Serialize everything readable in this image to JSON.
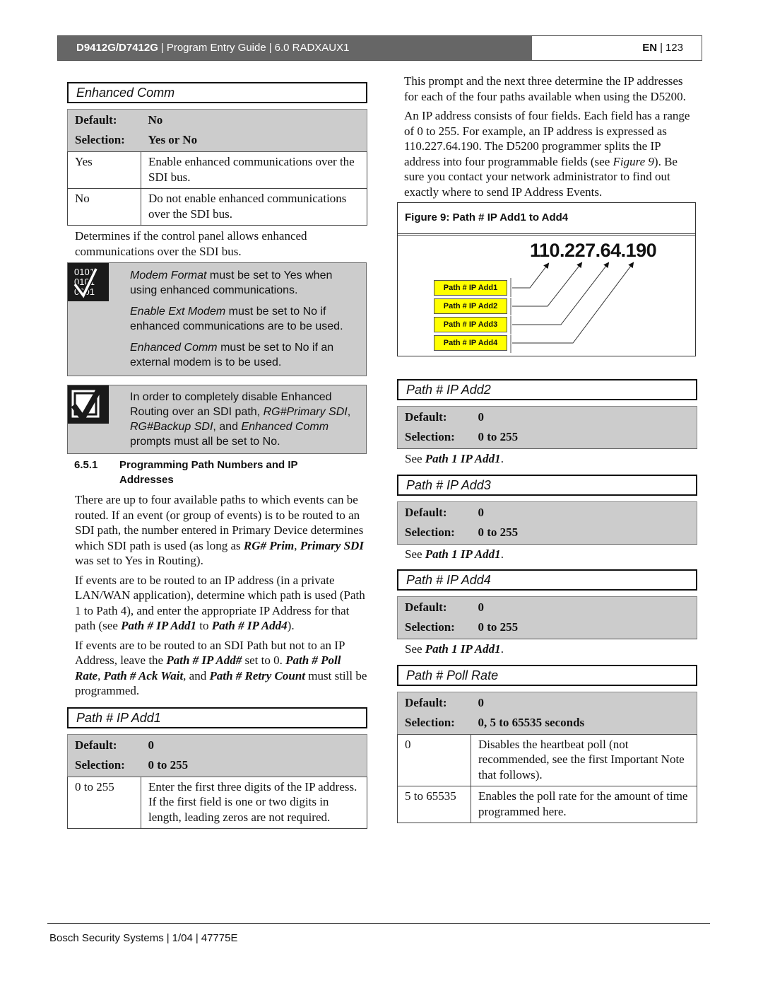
{
  "header": {
    "model": "D9412G/D7412G",
    "guide": "Program Entry Guide",
    "section": "6.0  RADXAUX1",
    "separator": "|",
    "lang": "EN",
    "page": "123"
  },
  "enhanced_comm": {
    "title": "Enhanced Comm",
    "default_label": "Default:",
    "default_value": "No",
    "selection_label": "Selection:",
    "selection_value": "Yes or No",
    "rows": [
      {
        "value": "Yes",
        "desc": "Enable enhanced communications over the SDI bus."
      },
      {
        "value": "No",
        "desc": "Do not enable enhanced communications over the SDI bus."
      }
    ],
    "description": "Determines if the control panel allows enhanced communications over the SDI bus."
  },
  "note1": {
    "icon": "binary-checkmark-icon",
    "items": [
      {
        "em": "Modem Format",
        "text": " must be set to Yes when using enhanced communications."
      },
      {
        "em": "Enable Ext Modem",
        "text": " must be set to No if enhanced communications are to be used."
      },
      {
        "em": "Enhanced Comm",
        "text": " must be set to No if an external modem is to be used."
      }
    ]
  },
  "note2": {
    "icon": "checkbox-checkmark-icon",
    "t1": "In order to completely disable Enhanced Routing over an SDI path, ",
    "em1": "RG#Primary SDI",
    "t2": ", ",
    "em2": "RG#Backup SDI",
    "t3": ", and ",
    "em3": "Enhanced Comm",
    "t4": " prompts must all be set to No."
  },
  "section_651": {
    "number": "6.5.1",
    "title": "Programming Path Numbers and IP Addresses",
    "p1": {
      "t1": "There are up to four available paths to which events can be routed. If an event (or group of events) is to be routed to an SDI path, the number entered in Primary Device determines which SDI path is used (as long as ",
      "b1": "RG# Prim",
      "t2": ", ",
      "b2": "Primary SDI",
      "t3": " was set to Yes in Routing)."
    },
    "p2": {
      "t1": "If events are to be routed to an IP address (in a private LAN/WAN application), determine which path is used (Path 1 to Path 4), and enter the appropriate IP Address for that path (see ",
      "b1": "Path # IP Add1",
      "t2": " to ",
      "b2": "Path # IP Add4",
      "t3": ")."
    },
    "p3": {
      "t1": "If events are to be routed to an SDI Path but not to an IP Address, leave the ",
      "b1": "Path # IP Add#",
      "t2": " set to 0. ",
      "b2": "Path # Poll Rate",
      "t3": ", ",
      "b3": "Path # Ack Wait",
      "t4": ", and ",
      "b4": "Path # Retry Count",
      "t5": " must still be programmed."
    }
  },
  "ip_add1": {
    "title": "Path # IP Add1",
    "default_label": "Default:",
    "default_value": "0",
    "selection_label": "Selection:",
    "selection_value": "0 to 255",
    "rows": [
      {
        "value": "0 to 255",
        "desc": "Enter the first three digits of the IP address. If the first field is one or two digits in length, leading zeros are not required."
      }
    ]
  },
  "right_intro": {
    "p1": "This prompt and the next three determine the IP addresses for each of the four paths available when using the D5200.",
    "p2a": "An IP address consists of four fields. Each field has a range of 0 to 255. For example, an IP address is expressed as 110.227.64.190. The D5200 programmer splits the IP address into four programmable fields (see ",
    "p2em": "Figure 9",
    "p2b": "). Be sure you contact your network administrator to find out exactly where to send IP Address Events."
  },
  "figure9": {
    "caption": "Figure 9: Path # IP Add1 to Add4",
    "ip": "110.227.64.190",
    "labels": [
      "Path # IP Add1",
      "Path # IP Add2",
      "Path # IP Add3",
      "Path # IP Add4"
    ],
    "label_color": "#ffff00"
  },
  "ip_add2": {
    "title": "Path # IP Add2",
    "default_label": "Default:",
    "default_value": "0",
    "selection_label": "Selection:",
    "selection_value": "0 to 255",
    "see": "See ",
    "see_ref": "Path 1 IP Add1",
    "see_end": "."
  },
  "ip_add3": {
    "title": "Path # IP Add3",
    "default_label": "Default:",
    "default_value": "0",
    "selection_label": "Selection:",
    "selection_value": "0 to 255",
    "see": "See ",
    "see_ref": "Path 1 IP Add1",
    "see_end": "."
  },
  "ip_add4": {
    "title": "Path # IP Add4",
    "default_label": "Default:",
    "default_value": "0",
    "selection_label": "Selection:",
    "selection_value": "0 to 255",
    "see": "See ",
    "see_ref": "Path 1 IP Add1",
    "see_end": "."
  },
  "poll_rate": {
    "title": "Path # Poll Rate",
    "default_label": "Default:",
    "default_value": "0",
    "selection_label": "Selection:",
    "selection_value": "0, 5 to 65535 seconds",
    "rows": [
      {
        "value": "0",
        "desc": "Disables the heartbeat poll (not recommended, see the first Important Note that follows)."
      },
      {
        "value": "5 to 65535",
        "desc": "Enables the poll rate for the amount of time programmed here."
      }
    ]
  },
  "footer": {
    "company": "Bosch Security Systems",
    "date": "1/04",
    "doc": "47775E",
    "separator": "|"
  }
}
